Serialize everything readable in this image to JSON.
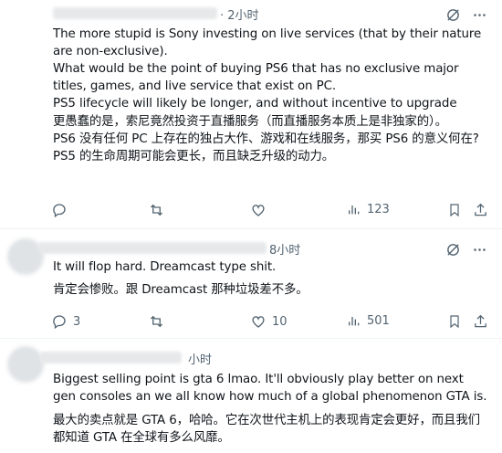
{
  "posts": [
    {
      "time": "· 2小时",
      "en": "The more stupid is Sony investing on live services (that by their nature are non-exclusive).\nWhat would be the point of buying PS6 that has no exclusive major titles, games, and live service that exist on PC.\nPS5 lifecycle will likely be longer, and without incentive to upgrade",
      "zh": "更愚蠢的是，索尼竟然投资于直播服务（而直播服务本质上是非独家的）。\nPS6 没有任何 PC 上存在的独占大作、游戏和在线服务，那买 PS6 的意义何在?\nPS5 的生命周期可能会更长，而且缺乏升级的动力。",
      "views": "123",
      "replies": "",
      "likes": ""
    },
    {
      "time": "8小时",
      "en": "It will flop hard. Dreamcast type shit.",
      "zh": "肯定会惨败。跟 Dreamcast 那种垃圾差不多。",
      "replies": "3",
      "likes": "10",
      "views": "501"
    },
    {
      "time": "小时",
      "en": "Biggest selling point is gta 6 lmao. It'll obviously play better on next gen consoles an we all know how much of a global phenomenon GTA is.",
      "zh": "最大的卖点就是 GTA 6，哈哈。它在次世代主机上的表现肯定会更好，而且我们都知道 GTA 在全球有多么风靡。"
    }
  ]
}
